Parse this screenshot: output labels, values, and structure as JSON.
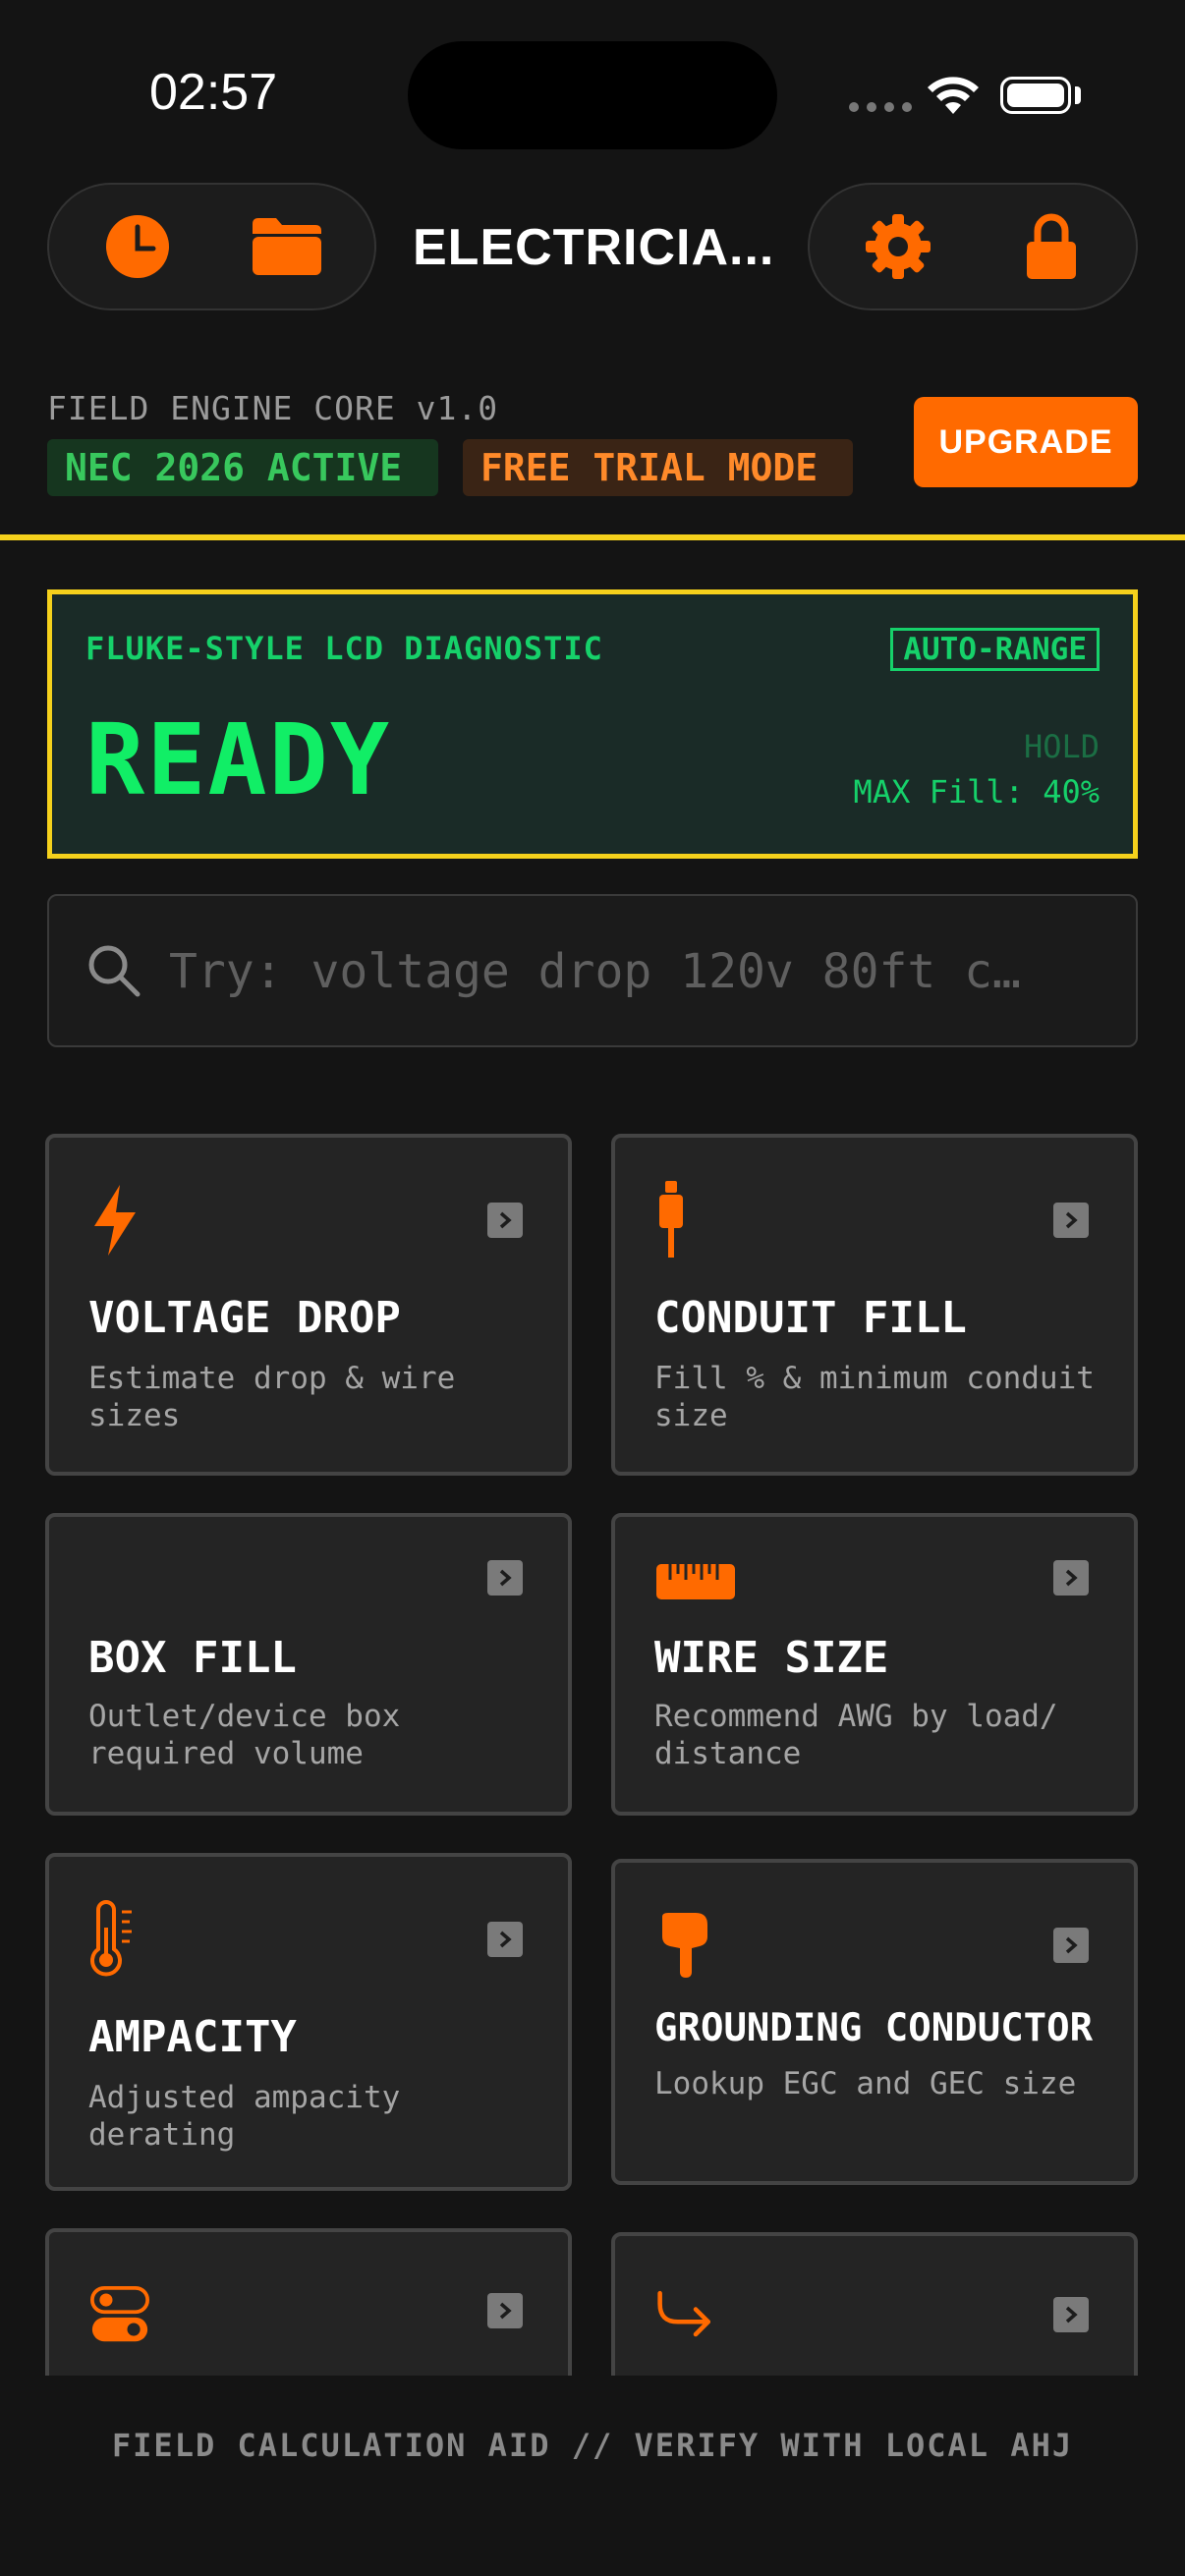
{
  "status_bar": {
    "time": "02:57"
  },
  "header": {
    "title": "ELECTRICIA..."
  },
  "banner": {
    "engine": "FIELD ENGINE CORE v1.0",
    "nec_tag": "NEC 2026 ACTIVE",
    "trial_tag": "FREE TRIAL MODE",
    "upgrade_label": "UPGRADE"
  },
  "lcd": {
    "label": "FLUKE-STYLE LCD DIAGNOSTIC",
    "auto_range": "AUTO-RANGE",
    "reading": "READY",
    "hold": "HOLD",
    "max_fill": "MAX Fill: 40%"
  },
  "search": {
    "placeholder": "Try: voltage drop 120v 80ft c…"
  },
  "cards": [
    {
      "title": "VOLTAGE DROP",
      "desc": "Estimate drop & wire sizes",
      "icon": "bolt-icon"
    },
    {
      "title": "CONDUIT FILL",
      "desc": "Fill % & minimum conduit size",
      "icon": "plug-icon"
    },
    {
      "title": "BOX FILL",
      "desc": "Outlet/device box required volume",
      "icon": ""
    },
    {
      "title": "WIRE SIZE",
      "desc": "Recommend AWG by load/ distance",
      "icon": "ruler-icon"
    },
    {
      "title": "AMPACITY",
      "desc": "Adjusted ampacity derating",
      "icon": "thermometer-icon"
    },
    {
      "title": "GROUNDING CONDUCTOR",
      "desc": "Lookup EGC and GEC size",
      "icon": "hand-pointing-down-icon"
    },
    {
      "title": "",
      "desc": "",
      "icon": "toggle-icon"
    },
    {
      "title": "",
      "desc": "",
      "icon": "turn-right-arrow-icon"
    }
  ],
  "footer": {
    "text": "FIELD CALCULATION AID // VERIFY WITH LOCAL AHJ"
  },
  "colors": {
    "accent": "#ff6a00",
    "lcd_green": "#11ee66",
    "divider_yellow": "#f5d11c"
  }
}
